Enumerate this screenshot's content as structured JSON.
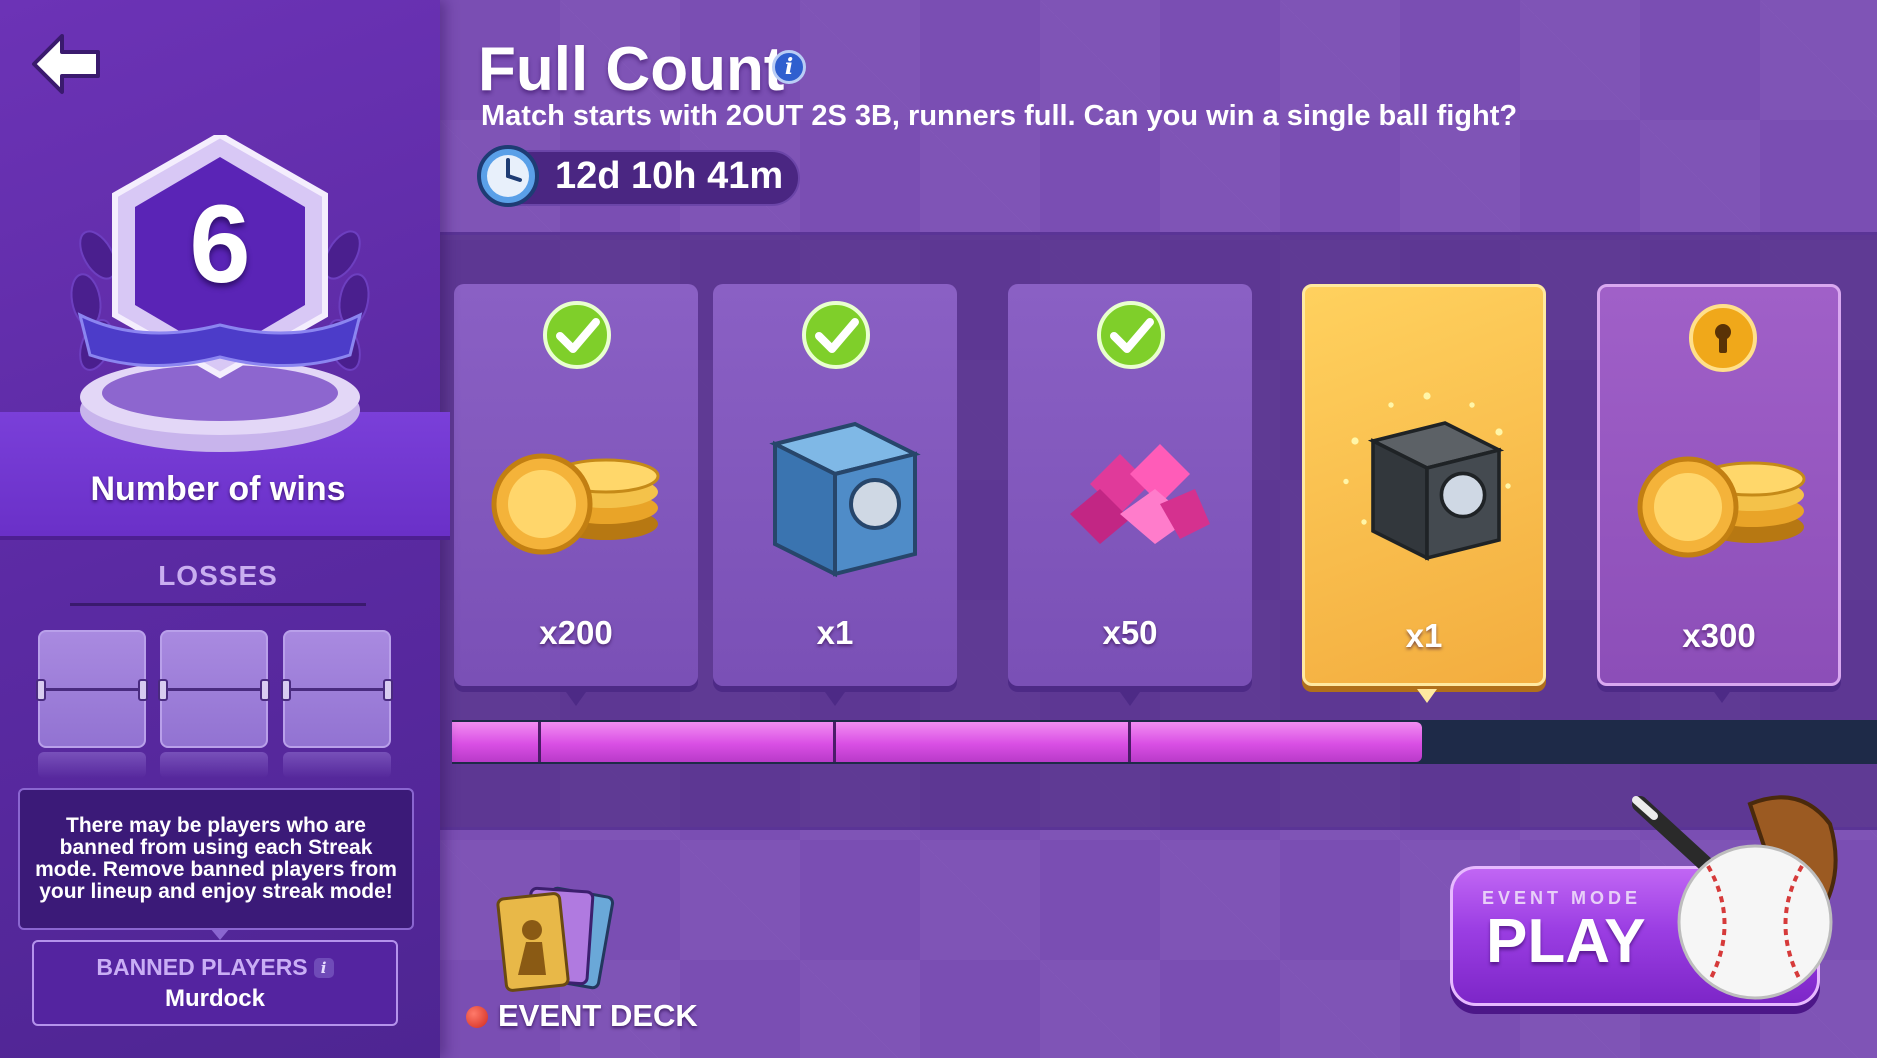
{
  "event": {
    "title": "Full Count",
    "description": "Match starts with 2OUT 2S 3B, runners full. Can you win a single ball fight?",
    "timer": "12d 10h 41m"
  },
  "left_panel": {
    "wins_count": "6",
    "wins_label": "Number of wins",
    "losses_label": "LOSSES",
    "loss_slots": 3,
    "info_text": "There may be players who are banned from using each Streak mode. Remove banned players from your lineup and enjoy streak mode!",
    "banned_title": "BANNED PLAYERS",
    "banned_name": "Murdock"
  },
  "rewards": [
    {
      "icon": "gold-coins-icon",
      "amount": "x200",
      "state": "claimed"
    },
    {
      "icon": "blue-chest-icon",
      "amount": "x1",
      "state": "claimed"
    },
    {
      "icon": "pink-gems-icon",
      "amount": "x50",
      "state": "claimed"
    },
    {
      "icon": "dark-chest-icon",
      "amount": "x1",
      "state": "current"
    },
    {
      "icon": "gold-coins-icon",
      "amount": "x300",
      "state": "locked"
    }
  ],
  "progress": {
    "completed_steps": 4,
    "total_steps": 5
  },
  "footer": {
    "event_deck_label": "EVENT DECK",
    "play_sub": "EVENT MODE",
    "play_label": "PLAY"
  },
  "colors": {
    "panel": "#5b2aa3",
    "background": "#7a4eb3",
    "accent_gold": "#f3ad3f",
    "progress": "#d94fe4",
    "check_green": "#7fcf2a"
  }
}
